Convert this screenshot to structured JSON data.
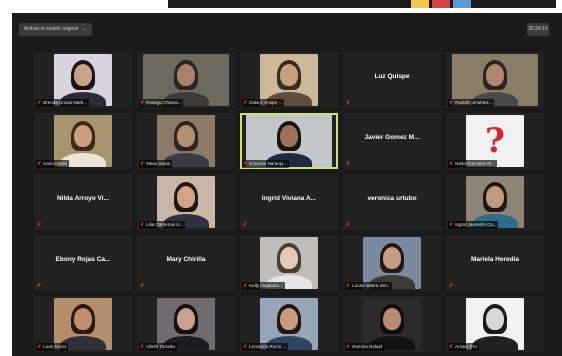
{
  "top_strip": {
    "swatch_colors": [
      "#f2c94c",
      "#d64545",
      "#5a9bd5"
    ]
  },
  "toolbar": {
    "original_sound_label": "Activar el sonido original",
    "caret": "⌄",
    "view_label": "35,94:15"
  },
  "colors": {
    "active_speaker": "#cfe06a",
    "muted_mic": "#e23b3b",
    "tile_bg": "#222222"
  },
  "participants": [
    {
      "name": "Brenda Ursula Mark...",
      "video": true,
      "video_bg": "#d7d3df",
      "hair": "#1b1311",
      "skin": "#c9a28a",
      "shirt": "#2c2c36"
    },
    {
      "name": "Rodrigo Chama...",
      "video": true,
      "wide": true,
      "video_bg": "#6b6a5d",
      "hair": "#2a241e",
      "skin": "#a7816a",
      "shirt": "#3d3b3a"
    },
    {
      "name": "Dalia I. Arispe ...",
      "video": true,
      "video_bg": "#cdb89a",
      "hair": "#3a2c22",
      "skin": "#c6a07f",
      "shirt": "#5e4c3c"
    },
    {
      "name": "Luz Quispe",
      "video": false
    },
    {
      "name": "Rodolfo Jiménez...",
      "video": true,
      "wide": true,
      "video_bg": "#8a7d68",
      "hair": "#2a241e",
      "skin": "#b08870",
      "shirt": "#4a4a4a"
    },
    {
      "name": "Karla Ojeda",
      "video": true,
      "video_bg": "#a8946f",
      "hair": "#3b2818",
      "skin": "#caa07d",
      "shirt": "#ece5d5"
    },
    {
      "name": "Mario Salas",
      "video": true,
      "video_bg": "#8b7a68",
      "hair": "#2b2420",
      "skin": "#b58e70",
      "shirt": "#3b3b42"
    },
    {
      "name": "Eduardo Naranjo...",
      "video": true,
      "wide": true,
      "active": true,
      "video_bg": "#c3c7c9",
      "hair": "#171412",
      "skin": "#9b7358",
      "shirt": "#1f2a44"
    },
    {
      "name": "Javier Gomez M...",
      "video": false
    },
    {
      "name": "Karla Gonzalez M...",
      "video": true,
      "question_mark": true,
      "video_bg": "#f1f1f1"
    },
    {
      "name": "Nilda Arroyo Vi...",
      "video": false
    },
    {
      "name": "Lilia Cárdenas U...",
      "video": true,
      "video_bg": "#c8b7a6",
      "hair": "#22160f",
      "skin": "#d0a587",
      "shirt": "#2f3140"
    },
    {
      "name": "Ingrid Viviana A...",
      "video": false
    },
    {
      "name": "veronica urtubo",
      "video": false
    },
    {
      "name": "Ingrid Jaramillo Ca...",
      "video": true,
      "video_bg": "#8e8577",
      "hair": "#1f1712",
      "skin": "#c09a80",
      "shirt": "#2f6c8a"
    },
    {
      "name": "Ebony Rojas Ca...",
      "video": false
    },
    {
      "name": "Mary Chirilla",
      "video": false
    },
    {
      "name": "Kelly Alejandro...",
      "video": true,
      "video_bg": "#bfbcbc",
      "hair": "#4b3b30",
      "skin": "#e2c9b8",
      "shirt": "#e6e6e6"
    },
    {
      "name": "Lucas Valera Jen...",
      "video": true,
      "video_bg": "#7a8aa0",
      "hair": "#231912",
      "skin": "#c69f82",
      "shirt": "#3e3a35"
    },
    {
      "name": "Mariela Heredia",
      "video": false
    },
    {
      "name": "Luan Rocio",
      "video": true,
      "video_bg": "#b48d6a",
      "hair": "#2a1a10",
      "skin": "#c48e6b",
      "shirt": "#30303a"
    },
    {
      "name": "Ubeth Torrales",
      "video": true,
      "video_bg": "#6f6b6f",
      "hair": "#120e0d",
      "skin": "#caa191",
      "shirt": "#1b1b20"
    },
    {
      "name": "Leonardo Rocío ...",
      "video": true,
      "video_bg": "#96a6b6",
      "hair": "#1e1812",
      "skin": "#c69c7c",
      "shirt": "#2d4560"
    },
    {
      "name": "Romina Rafael",
      "video": true,
      "video_bg": "#2b2b2b",
      "hair": "#0f0b0a",
      "skin": "#b88a73",
      "shirt": "#111111"
    },
    {
      "name": "Amaro Pro",
      "video": true,
      "video_bg": "#f2f2f2",
      "hair": "#1a1a1a",
      "skin": "#d8d8d8",
      "shirt": "#222222"
    }
  ]
}
